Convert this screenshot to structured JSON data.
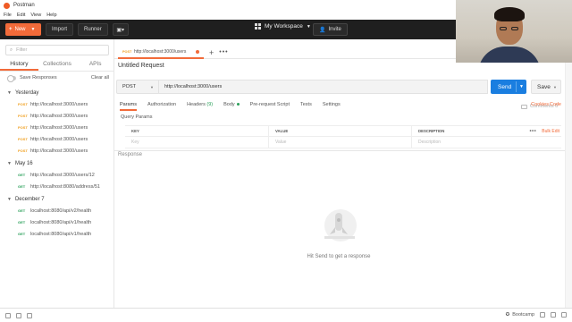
{
  "window": {
    "title": "Postman"
  },
  "menu": [
    "File",
    "Edit",
    "View",
    "Help"
  ],
  "toolbar": {
    "new_label": "New",
    "import_label": "Import",
    "runner_label": "Runner",
    "workspace_label": "My Workspace",
    "invite_label": "Invite"
  },
  "sidebar": {
    "filter_placeholder": "Filter",
    "tabs": [
      "History",
      "Collections",
      "APIs"
    ],
    "save_responses_label": "Save Responses",
    "clear_all_label": "Clear all",
    "groups": [
      {
        "label": "Yesterday",
        "items": [
          {
            "method": "POST",
            "url": "http://localhost:3000/users"
          },
          {
            "method": "POST",
            "url": "http://localhost:3000/users"
          },
          {
            "method": "POST",
            "url": "http://localhost:3000/users"
          },
          {
            "method": "POST",
            "url": "http://localhost:3000/users"
          },
          {
            "method": "POST",
            "url": "http://localhost:3000/users"
          }
        ]
      },
      {
        "label": "May 16",
        "items": [
          {
            "method": "GET",
            "url": "http://localhost:3000/users/12"
          },
          {
            "method": "GET",
            "url": "http://localhost:8080/address/51"
          }
        ]
      },
      {
        "label": "December 7",
        "items": [
          {
            "method": "GET",
            "url": "localhost:8080/api/v2/health"
          },
          {
            "method": "GET",
            "url": "localhost:8080/api/v1/health"
          },
          {
            "method": "GET",
            "url": "localhost:8080/api/v1/health"
          }
        ]
      }
    ]
  },
  "request_tab": {
    "method": "POST",
    "url": "http://localhost:3000/users"
  },
  "request": {
    "name": "Untitled Request",
    "method": "POST",
    "url": "http://localhost:3000/users",
    "send_label": "Send",
    "save_label": "Save",
    "comments_label": "Comments 0"
  },
  "subtabs": {
    "params": "Params",
    "authorization": "Authorization",
    "headers": "Headers",
    "headers_count": "(9)",
    "body": "Body",
    "prerequest": "Pre-request Script",
    "tests": "Tests",
    "settings": "Settings",
    "cookies": "Cookies",
    "code": "Code"
  },
  "params_table": {
    "title": "Query Params",
    "headers": [
      "KEY",
      "VALUE",
      "DESCRIPTION"
    ],
    "bulk_edit": "Bulk Edit",
    "placeholders": [
      "Key",
      "Value",
      "Description"
    ]
  },
  "response": {
    "label": "Response",
    "empty_text": "Hit Send to get a response"
  },
  "statusbar": {
    "bootcamp_label": "Bootcamp"
  },
  "colors": {
    "accent": "#f26b3a",
    "send": "#1a7ee0",
    "post": "#f0a020",
    "get": "#2aa05a"
  }
}
